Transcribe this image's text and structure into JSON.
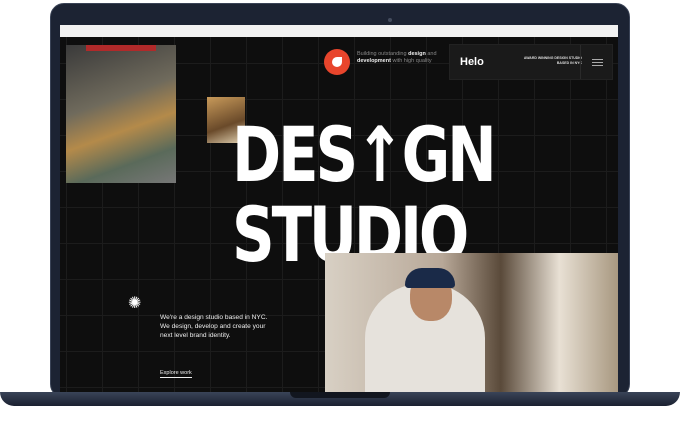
{
  "header": {
    "tagline_pre": "Building outstanding ",
    "tagline_b1": "design",
    "tagline_mid": " and ",
    "tagline_b2": "development",
    "tagline_post": " with high quality",
    "brand": "Helo",
    "award": "AWARD WINNING DESIGN STUDIO BASED IN NYC"
  },
  "hero": {
    "line1_a": "DES",
    "line1_arrow": "↑",
    "line1_b": "GN",
    "line2": "STUDIO"
  },
  "about": {
    "text": "We're a design studio based in NYC. We design, develop and create your next level brand identity.",
    "link": "Explore work"
  },
  "colors": {
    "accent": "#e8452c",
    "background": "#0e0e0e"
  }
}
